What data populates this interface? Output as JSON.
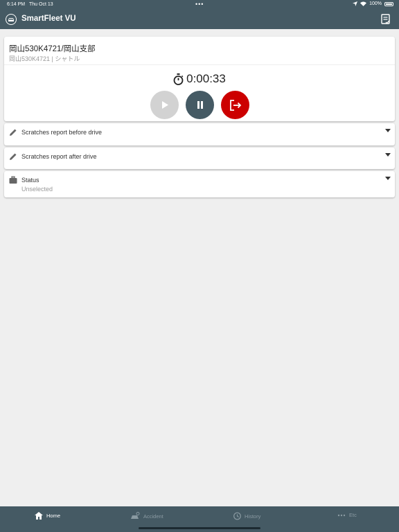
{
  "status_bar": {
    "time": "6:14 PM",
    "date": "Thu Oct 13",
    "dots": "•••",
    "battery": "100%"
  },
  "header": {
    "title": "SmartFleet VU",
    "logo_icon": "car-icon",
    "action_icon": "checklist-icon"
  },
  "vehicle": {
    "title": "岡山530K4721/岡山支部",
    "subtitle": "岡山530K4721 | シャトル"
  },
  "timer": {
    "icon": "stopwatch-icon",
    "value": "0:00:33"
  },
  "controls": {
    "play": {
      "icon": "play-icon",
      "color": "#d2d2d2"
    },
    "pause": {
      "icon": "pause-icon",
      "color": "#455a64"
    },
    "exit": {
      "icon": "exit-icon",
      "color": "#cc0000"
    }
  },
  "sections": [
    {
      "label": "Scratches report before drive",
      "icon": "pencil-icon"
    },
    {
      "label": "Scratches report after drive",
      "icon": "pencil-icon"
    },
    {
      "label": "Status",
      "value": "Unselected",
      "icon": "briefcase-icon"
    }
  ],
  "bottom_nav": [
    {
      "label": "Home",
      "icon": "home-icon",
      "active": true
    },
    {
      "label": "Accident",
      "icon": "accident-icon",
      "active": false
    },
    {
      "label": "History",
      "icon": "history-icon",
      "active": false
    },
    {
      "label": "Etc",
      "icon": "more-icon",
      "active": false
    }
  ],
  "colors": {
    "primary": "#455a64",
    "danger": "#cc0000",
    "disabled": "#d2d2d2",
    "background": "#efefef"
  }
}
